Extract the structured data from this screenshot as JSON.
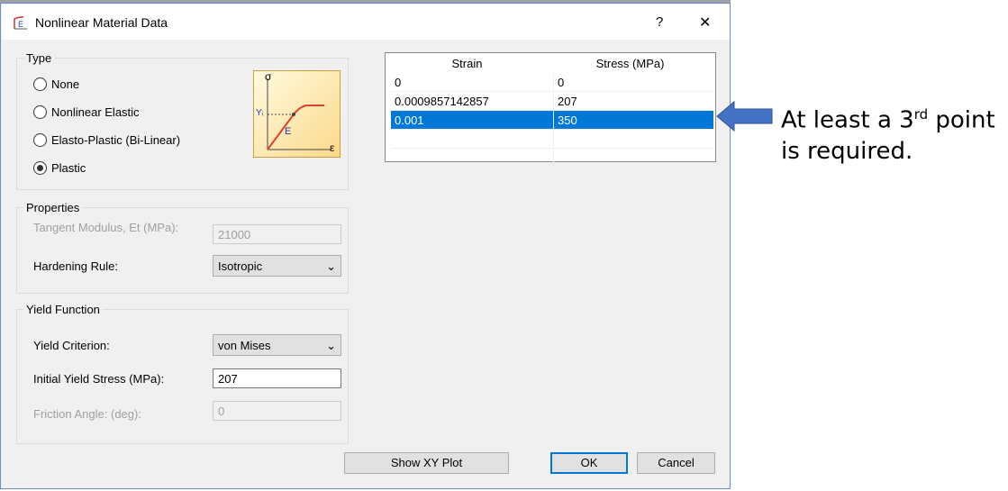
{
  "window": {
    "title": "Nonlinear Material Data",
    "help": "?",
    "close": "✕"
  },
  "type": {
    "label": "Type",
    "options": [
      {
        "label": "None",
        "selected": false
      },
      {
        "label": "Nonlinear Elastic",
        "selected": false
      },
      {
        "label": "Elasto-Plastic (Bi-Linear)",
        "selected": false
      },
      {
        "label": "Plastic",
        "selected": true
      }
    ],
    "diagram": {
      "sigma": "σ",
      "yield": "Yᵢ",
      "modulus": "E",
      "epsilon": "ε"
    }
  },
  "properties": {
    "label": "Properties",
    "tangent_label": "Tangent Modulus, Et (MPa):",
    "tangent_value": "21000",
    "hardening_label": "Hardening Rule:",
    "hardening_value": "Isotropic"
  },
  "yield": {
    "label": "Yield Function",
    "criterion_label": "Yield Criterion:",
    "criterion_value": "von Mises",
    "stress_label": "Initial Yield Stress (MPa):",
    "stress_value": "207",
    "friction_label": "Friction Angle: (deg):",
    "friction_value": "0"
  },
  "table": {
    "headers": [
      "Strain",
      "Stress (MPa)"
    ],
    "rows": [
      [
        "0",
        "0"
      ],
      [
        "0.0009857142857",
        "207"
      ],
      [
        "0.001",
        "350"
      ],
      [
        "",
        ""
      ],
      [
        "",
        ""
      ]
    ],
    "selected_row": 2
  },
  "buttons": {
    "plot": "Show XY Plot",
    "ok": "OK",
    "cancel": "Cancel"
  },
  "annotation": {
    "line1_pre": "At least a 3",
    "line1_sup": "rd",
    "line1_post": " point",
    "line2": "is required.",
    "color": "#4472c4"
  }
}
